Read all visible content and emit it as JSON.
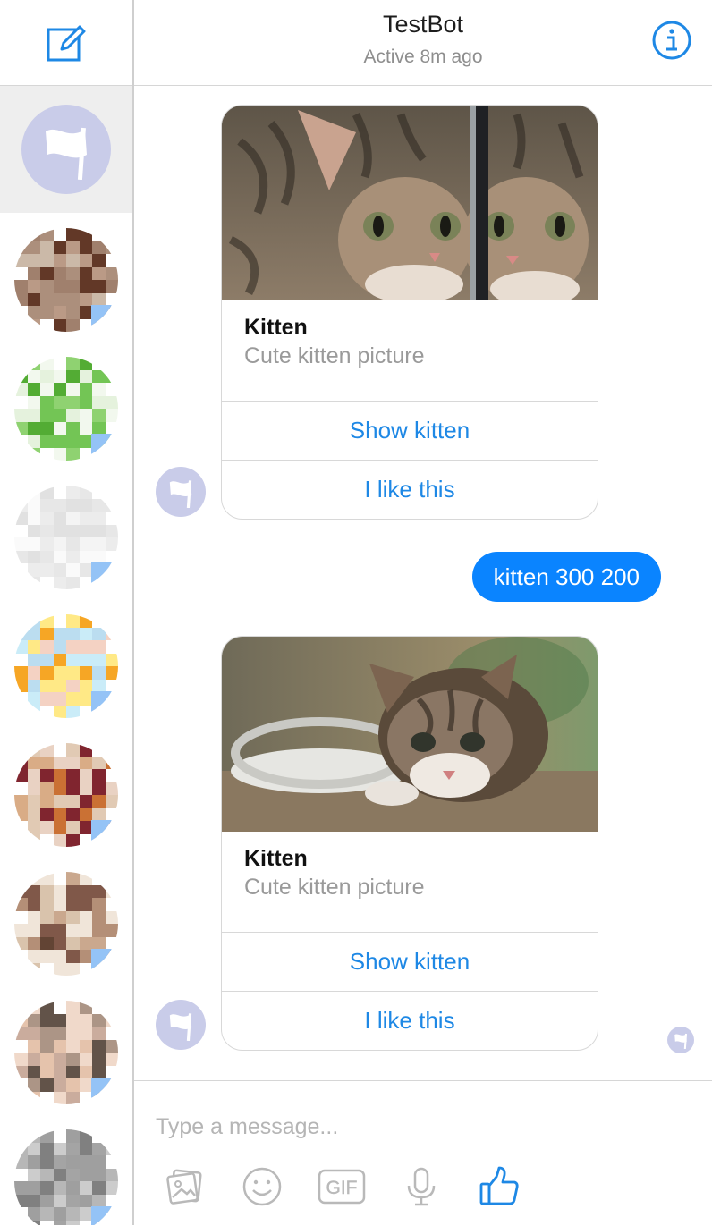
{
  "header": {
    "title": "TestBot",
    "status": "Active 8m ago",
    "compose_icon": "compose-icon",
    "info_icon": "info-icon"
  },
  "sidebar": {
    "conversations": [
      {
        "kind": "bot",
        "avatar": "flag-icon",
        "active": true
      },
      {
        "kind": "contact",
        "avatar": "pixelated-avatar"
      },
      {
        "kind": "contact",
        "avatar": "pixelated-avatar"
      },
      {
        "kind": "contact",
        "avatar": "pixelated-avatar"
      },
      {
        "kind": "contact",
        "avatar": "pixelated-avatar"
      },
      {
        "kind": "contact",
        "avatar": "pixelated-avatar"
      },
      {
        "kind": "contact",
        "avatar": "pixelated-avatar"
      },
      {
        "kind": "contact",
        "avatar": "pixelated-avatar"
      },
      {
        "kind": "contact",
        "avatar": "pixelated-avatar"
      }
    ]
  },
  "messages": [
    {
      "type": "card",
      "from": "bot",
      "title": "Kitten",
      "subtitle": "Cute kitten picture",
      "buttons": [
        "Show kitten",
        "I like this"
      ]
    },
    {
      "type": "text",
      "from": "user",
      "text": "kitten 300 200"
    },
    {
      "type": "card",
      "from": "bot",
      "title": "Kitten",
      "subtitle": "Cute kitten picture",
      "buttons": [
        "Show kitten",
        "I like this"
      ]
    }
  ],
  "composer": {
    "placeholder": "Type a message...",
    "tools": [
      "image-icon",
      "emoji-icon",
      "gif-icon",
      "microphone-icon",
      "thumbs-up-icon"
    ],
    "gif_label": "GIF"
  },
  "colors": {
    "accent": "#0a84ff",
    "link": "#1e88e5",
    "bot_avatar": "#c9cce9",
    "sidebar_active": "#eeeeee"
  }
}
